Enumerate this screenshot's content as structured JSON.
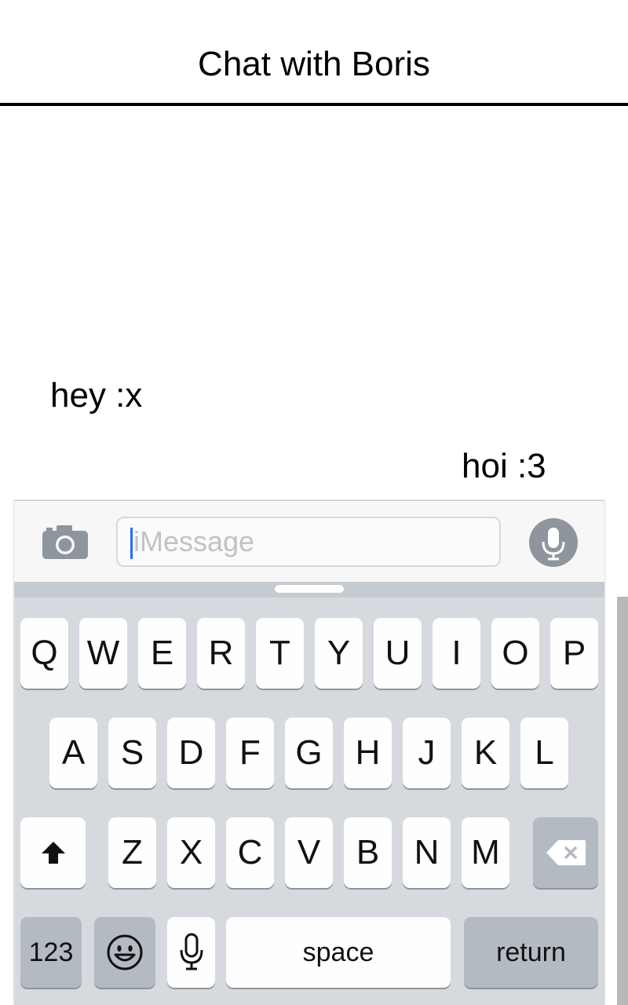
{
  "header": {
    "title": "Chat with Boris"
  },
  "messages": [
    {
      "text": "hey :x",
      "direction": "incoming"
    },
    {
      "text": "hoi :3",
      "direction": "outgoing"
    }
  ],
  "composer": {
    "placeholder": "iMessage",
    "value": ""
  },
  "keyboard": {
    "row1": [
      "Q",
      "W",
      "E",
      "R",
      "T",
      "Y",
      "U",
      "I",
      "O",
      "P"
    ],
    "row2": [
      "A",
      "S",
      "D",
      "F",
      "G",
      "H",
      "J",
      "K",
      "L"
    ],
    "row3": [
      "Z",
      "X",
      "C",
      "V",
      "B",
      "N",
      "M"
    ],
    "numbers_label": "123",
    "space_label": "space",
    "return_label": "return"
  },
  "icons": {
    "camera": "camera-icon",
    "mic": "microphone-icon",
    "shift": "shift-arrow-icon",
    "delete": "backspace-icon",
    "emoji": "emoji-icon",
    "dictation": "microphone-icon"
  },
  "colors": {
    "keyboard_bg": "#d6d9de",
    "key": "#fefefe",
    "key_dark": "#b4bac1",
    "cursor": "#2a6bff",
    "mic_bg": "#8e959c"
  }
}
